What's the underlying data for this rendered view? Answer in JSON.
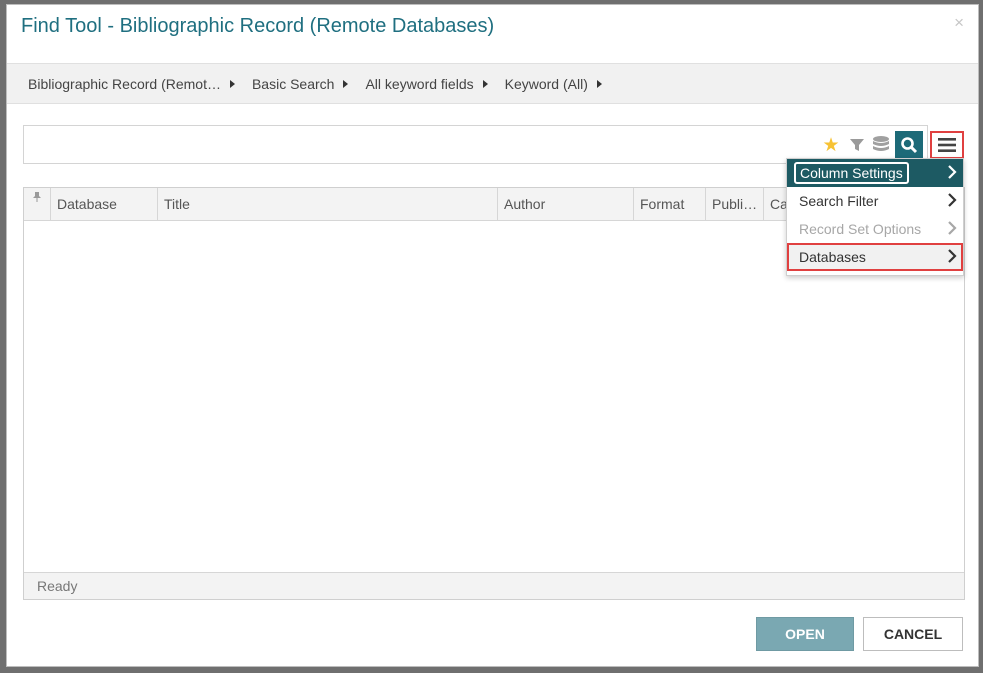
{
  "dialog": {
    "title": "Find Tool - Bibliographic Record (Remote Databases)",
    "close_glyph": "×"
  },
  "breadcrumb": [
    {
      "label": "Bibliographic Record (Remot…"
    },
    {
      "label": "Basic Search"
    },
    {
      "label": "All keyword fields"
    },
    {
      "label": "Keyword (All)"
    }
  ],
  "search": {
    "value": "",
    "placeholder": ""
  },
  "grid": {
    "columns": [
      {
        "label": "Database",
        "width": 107
      },
      {
        "label": "Title",
        "width": 340
      },
      {
        "label": "Author",
        "width": 136
      },
      {
        "label": "Format",
        "width": 72
      },
      {
        "label": "Publi…",
        "width": 58
      },
      {
        "label": "Ca",
        "width": 199
      }
    ],
    "status": "Ready"
  },
  "menu": {
    "items": [
      {
        "label": "Column Settings",
        "state": "active"
      },
      {
        "label": "Search Filter",
        "state": "normal"
      },
      {
        "label": "Record Set Options",
        "state": "disabled"
      },
      {
        "label": "Databases",
        "state": "highlight"
      }
    ]
  },
  "buttons": {
    "open": "OPEN",
    "cancel": "CANCEL"
  },
  "colors": {
    "title": "#1f6f80",
    "accent": "#1d6a78",
    "menu_active": "#1d5a63",
    "highlight_border": "#e04040",
    "star": "#f7c234"
  }
}
